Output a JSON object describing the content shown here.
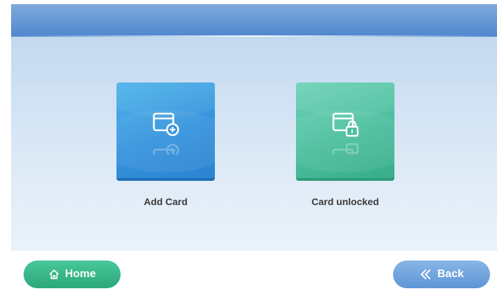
{
  "tiles": {
    "add_card": {
      "label": "Add Card",
      "icon": "card-plus-icon",
      "color": "#3593dd"
    },
    "card_unlocked": {
      "label": "Card unlocked",
      "icon": "card-lock-icon",
      "color": "#4cbf9e"
    }
  },
  "footer": {
    "home_label": "Home",
    "home_icon": "home-icon",
    "home_color": "#2ba87a",
    "back_label": "Back",
    "back_icon": "double-chevron-left-icon",
    "back_color": "#5d95d6"
  }
}
